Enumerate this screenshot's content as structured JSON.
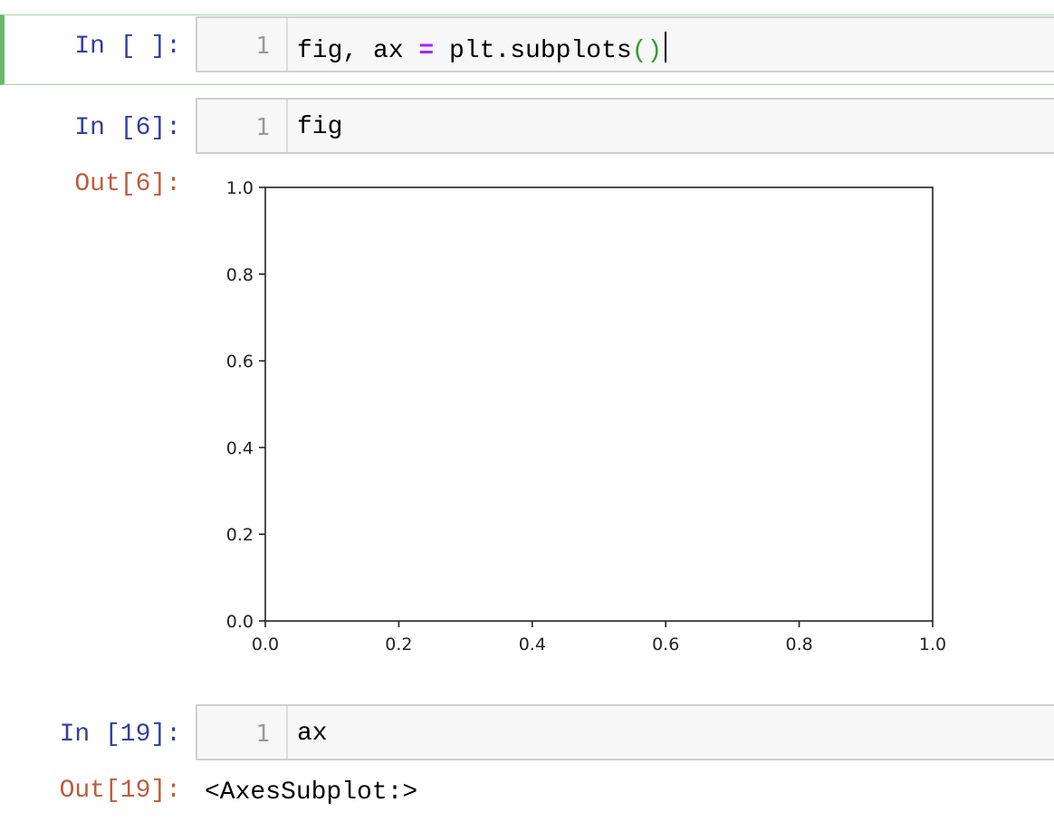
{
  "cells": [
    {
      "prompt": "In [ ]:",
      "line_number": "1",
      "code": {
        "t1": "fig, ax ",
        "op": "=",
        "t2": " plt.subplots",
        "paren": "()"
      }
    },
    {
      "prompt": "In [6]:",
      "line_number": "1",
      "code": {
        "t1": "fig"
      },
      "output_prompt": "Out[6]:"
    },
    {
      "prompt": "In [19]:",
      "line_number": "1",
      "code": {
        "t1": "ax"
      },
      "output_prompt": "Out[19]:",
      "output_text": "<AxesSubplot:>"
    }
  ],
  "colors": {
    "in_prompt": "#303f9f",
    "out_prompt": "#bf5b3d",
    "selected_border": "#66bb6a",
    "operator": "#aa22ff",
    "paren": "#2e9e2e"
  },
  "chart_data": {
    "type": "line",
    "series": [],
    "xlim": [
      0.0,
      1.0
    ],
    "ylim": [
      0.0,
      1.0
    ],
    "xticks": [
      "0.0",
      "0.2",
      "0.4",
      "0.6",
      "0.8",
      "1.0"
    ],
    "yticks": [
      "0.0",
      "0.2",
      "0.4",
      "0.6",
      "0.8",
      "1.0"
    ],
    "grid": false
  }
}
